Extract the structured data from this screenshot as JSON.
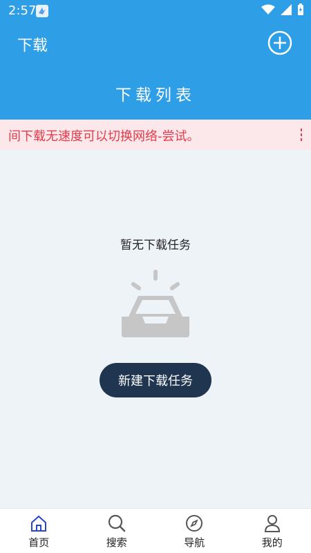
{
  "status_bar": {
    "time": "2:57"
  },
  "app_bar": {
    "left_title": "下载",
    "center_title": "下载列表"
  },
  "notice": {
    "text": "间下载无速度可以切换网络-尝试。"
  },
  "empty_state": {
    "title": "暂无下载任务",
    "action_label": "新建下载任务"
  },
  "tabs": [
    {
      "label": "首页",
      "icon": "home-icon",
      "active": true
    },
    {
      "label": "搜索",
      "icon": "search-icon",
      "active": false
    },
    {
      "label": "导航",
      "icon": "compass-icon",
      "active": false
    },
    {
      "label": "我的",
      "icon": "user-icon",
      "active": false
    }
  ],
  "colors": {
    "primary": "#2e9ee6",
    "notice_bg": "#fce8ea",
    "notice_text": "#e8394a",
    "button_dark": "#1f3550",
    "active_tab": "#2946c9"
  }
}
